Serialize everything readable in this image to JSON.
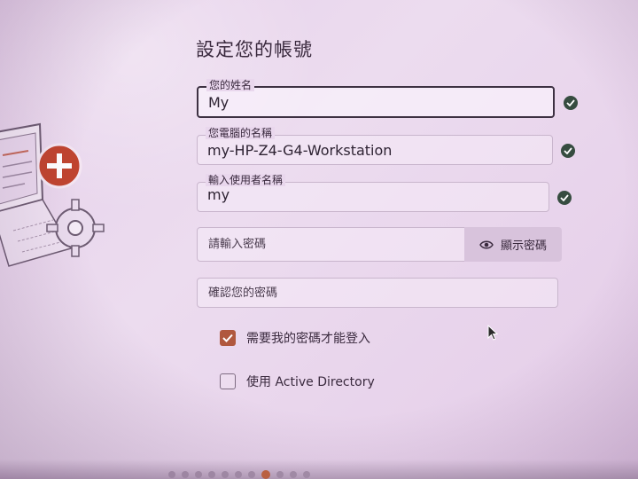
{
  "page": {
    "title": "設定您的帳號"
  },
  "fields": {
    "name": {
      "label": "您的姓名",
      "value": "My"
    },
    "computer": {
      "label": "您電腦的名稱",
      "value": "my-HP-Z4-G4-Workstation"
    },
    "username": {
      "label": "輸入使用者名稱",
      "value": "my"
    },
    "password": {
      "placeholder": "請輸入密碼"
    },
    "confirm": {
      "placeholder": "確認您的密碼"
    }
  },
  "show_password": {
    "label": "顯示密碼",
    "icon": "eye-icon"
  },
  "options": {
    "require_password": {
      "label": "需要我的密碼才能登入",
      "checked": true
    },
    "active_directory": {
      "label": "使用 Active Directory",
      "checked": false
    }
  },
  "pager": {
    "total": 11,
    "current": 8
  },
  "colors": {
    "accent": "#b0583e",
    "valid": "#364c40",
    "background": "#e8d5ec"
  }
}
